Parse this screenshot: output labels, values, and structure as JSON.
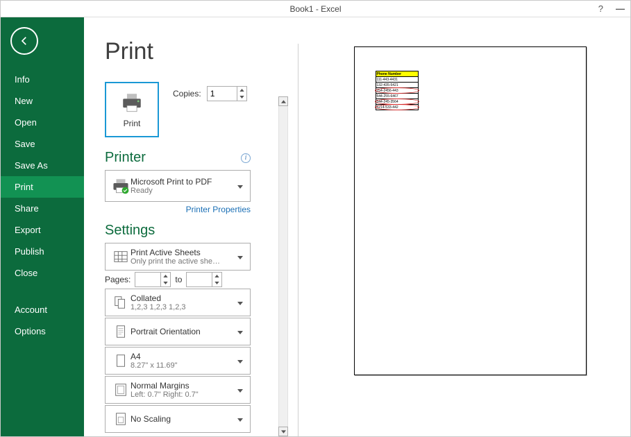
{
  "titlebar": {
    "title": "Book1 - Excel"
  },
  "sidebar": {
    "items": [
      {
        "label": "Info"
      },
      {
        "label": "New"
      },
      {
        "label": "Open"
      },
      {
        "label": "Save"
      },
      {
        "label": "Save As"
      },
      {
        "label": "Print"
      },
      {
        "label": "Share"
      },
      {
        "label": "Export"
      },
      {
        "label": "Publish"
      },
      {
        "label": "Close"
      }
    ],
    "footer": [
      {
        "label": "Account"
      },
      {
        "label": "Options"
      }
    ]
  },
  "page": {
    "title": "Print",
    "print_button": "Print",
    "copies_label": "Copies:",
    "copies_value": "1"
  },
  "printer": {
    "heading": "Printer",
    "name": "Microsoft Print to PDF",
    "status": "Ready",
    "properties_link": "Printer Properties"
  },
  "settings": {
    "heading": "Settings",
    "sheets_title": "Print Active Sheets",
    "sheets_sub": "Only print the active she…",
    "pages_label": "Pages:",
    "pages_to": "to",
    "collate_title": "Collated",
    "collate_sub": "1,2,3    1,2,3    1,2,3",
    "orient_title": "Portrait Orientation",
    "paper_title": "A4",
    "paper_sub": "8.27\" x 11.69\"",
    "margins_title": "Normal Margins",
    "margins_sub": "Left:  0.7\"    Right:  0.7\"",
    "scaling_title": "No Scaling"
  },
  "preview": {
    "header": "Phone Number",
    "rows": [
      {
        "text": "111-443-4431",
        "circled": false
      },
      {
        "text": "132-435-5421",
        "circled": false
      },
      {
        "text": "254-2456-443",
        "circled": true
      },
      {
        "text": "544-255-6467",
        "circled": false
      },
      {
        "text": "544-245-3564",
        "circled": true
      },
      {
        "text": "5214-533-442",
        "circled": true
      }
    ]
  }
}
